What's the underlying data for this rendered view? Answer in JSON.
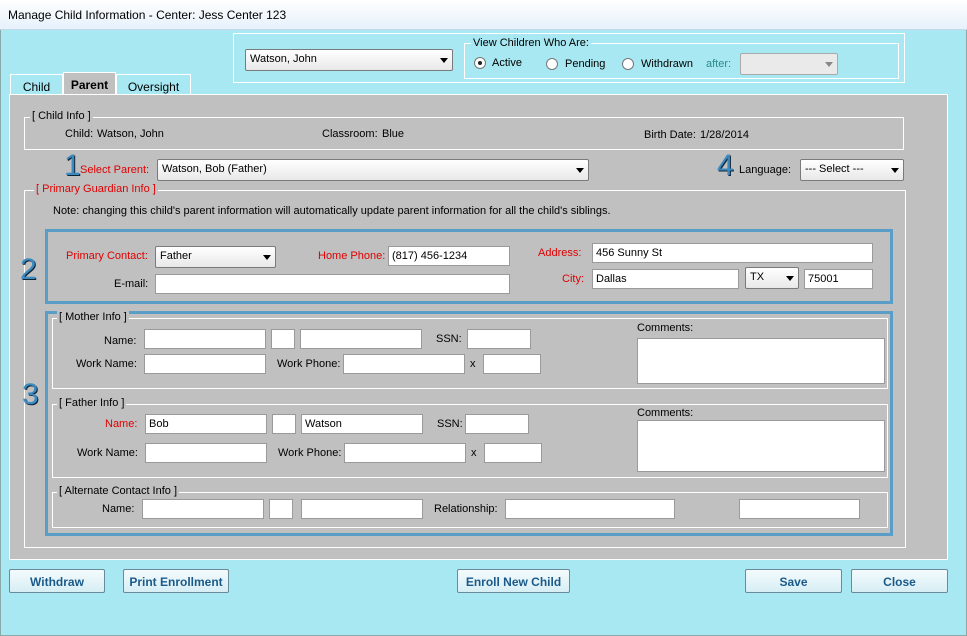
{
  "window": {
    "title": "Manage Child Information - Center: Jess Center   123"
  },
  "top": {
    "child_select": "Watson, John",
    "view_legend": "View Children Who Are:",
    "status_options": [
      {
        "label": "Active",
        "selected": true
      },
      {
        "label": "Pending",
        "selected": false
      },
      {
        "label": "Withdrawn",
        "selected": false
      }
    ],
    "after_label": "after:",
    "after_value": ""
  },
  "tabs": [
    {
      "label": "Child",
      "active": false
    },
    {
      "label": "Parent",
      "active": true
    },
    {
      "label": "Oversight",
      "active": false
    }
  ],
  "child_info": {
    "legend": "[ Child Info ]",
    "child_label": "Child:",
    "child_value": "Watson, John",
    "classroom_label": "Classroom:",
    "classroom_value": "Blue",
    "birth_label": "Birth Date:",
    "birth_value": "1/28/2014"
  },
  "markers": {
    "one": "1",
    "two": "2",
    "three": "3",
    "four": "4"
  },
  "select_parent": {
    "label": "Select Parent:",
    "value": "Watson, Bob (Father)"
  },
  "language": {
    "label": "Language:",
    "value": "--- Select ---"
  },
  "primary_guardian": {
    "legend": "[ Primary Guardian Info ]",
    "note": "Note:  changing this child's parent information will automatically update parent information for all the child's siblings.",
    "primary_contact_label": "Primary Contact:",
    "primary_contact_value": "Father",
    "home_phone_label": "Home Phone:",
    "home_phone_value": "(817) 456-1234",
    "email_label": "E-mail:",
    "email_value": "",
    "address_label": "Address:",
    "address_value": "456 Sunny St",
    "city_label": "City:",
    "city_value": "Dallas",
    "state_value": "TX",
    "zip_value": "75001"
  },
  "mother": {
    "legend": "[ Mother Info ]",
    "name_label": "Name:",
    "first": "",
    "middle": "",
    "last": "",
    "ssn_label": "SSN:",
    "ssn": "",
    "work_name_label": "Work Name:",
    "work_name": "",
    "work_phone_label": "Work Phone:",
    "work_phone": "",
    "ext_label": "x",
    "ext": "",
    "comments_label": "Comments:",
    "comments": ""
  },
  "father": {
    "legend": "[ Father Info ]",
    "name_label": "Name:",
    "first": "Bob",
    "middle": "",
    "last": "Watson",
    "ssn_label": "SSN:",
    "ssn": "",
    "work_name_label": "Work Name:",
    "work_name": "",
    "work_phone_label": "Work Phone:",
    "work_phone": "",
    "ext_label": "x",
    "ext": "",
    "comments_label": "Comments:",
    "comments": ""
  },
  "alternate": {
    "legend": "[ Alternate Contact Info ]",
    "name_label": "Name:",
    "first": "",
    "middle": "",
    "last": "",
    "relationship_label": "Relationship:",
    "relationship": "",
    "extra": ""
  },
  "buttons": {
    "withdraw": "Withdraw",
    "print_enrollment": "Print Enrollment",
    "enroll_new": "Enroll New Child",
    "save": "Save",
    "close": "Close"
  }
}
